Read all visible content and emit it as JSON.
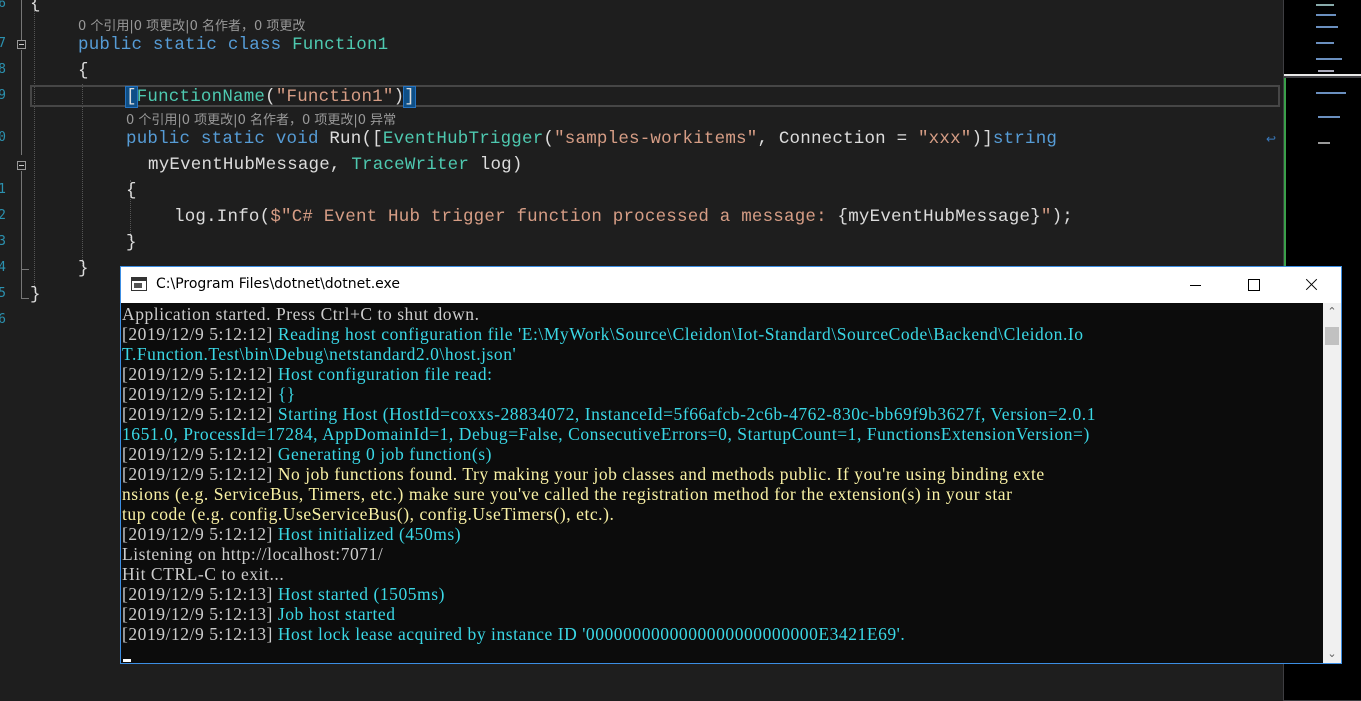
{
  "editor": {
    "line_numbers": [
      "6",
      "7",
      "8",
      "9",
      "0",
      "1",
      "2",
      "3",
      "4",
      "5",
      "6"
    ],
    "open_brace_top": "{",
    "codelens_class": "0 个引用|0 项更改|0 名作者，0 项更改",
    "codelens_method": "0 个引用|0 项更改|0 名作者，0 项更改|0 异常",
    "code": {
      "kw_public": "public",
      "kw_static": "static",
      "kw_class": "class",
      "class_name": "Function1",
      "brace_open": "{",
      "attr_open": "[",
      "attr_name": "FunctionName",
      "attr_paren_open": "(",
      "attr_value": "\"Function1\"",
      "attr_paren_close": ")",
      "attr_close": "]",
      "kw_void": "void",
      "method_name": "Run(",
      "trigger_open": "[",
      "trigger_name": "EventHubTrigger",
      "trigger_paren": "(",
      "trigger_value": "\"samples-workitems\"",
      "trigger_conn": ", Connection = ",
      "trigger_conn_value": "\"xxx\"",
      "trigger_close": ")]",
      "kw_string": "string",
      "param_line": "myEventHubMessage, ",
      "tracewriter": "TraceWriter",
      "log_param": " log)",
      "method_brace_open": "{",
      "log_call": "log.Info(",
      "log_string_open": "$\"C# Event Hub trigger function processed a message: ",
      "log_interp": "{myEventHubMessage}",
      "log_string_close": "\"",
      "log_end": ");",
      "method_brace_close": "}",
      "class_brace_close": "}",
      "ns_brace_close": "}"
    }
  },
  "console": {
    "title": "C:\\Program Files\\dotnet\\dotnet.exe",
    "lines": [
      {
        "ts": "",
        "text": "Application started. Press Ctrl+C to shut down.",
        "color": "gray"
      },
      {
        "ts": "[2019/12/9 5:12:12] ",
        "text": "Reading host configuration file 'E:\\MyWork\\Source\\Cleidon\\Iot-Standard\\SourceCode\\Backend\\Cleidon.Io",
        "color": "cyan"
      },
      {
        "ts": "",
        "text": "T.Function.Test\\bin\\Debug\\netstandard2.0\\host.json'",
        "color": "cyan"
      },
      {
        "ts": "[2019/12/9 5:12:12] ",
        "text": "Host configuration file read:",
        "color": "cyan"
      },
      {
        "ts": "[2019/12/9 5:12:12] ",
        "text": "{}",
        "color": "cyan"
      },
      {
        "ts": "[2019/12/9 5:12:12] ",
        "text": "Starting Host (HostId=coxxs-28834072, InstanceId=5f66afcb-2c6b-4762-830c-bb69f9b3627f, Version=2.0.1",
        "color": "cyan"
      },
      {
        "ts": "",
        "text": "1651.0, ProcessId=17284, AppDomainId=1, Debug=False, ConsecutiveErrors=0, StartupCount=1, FunctionsExtensionVersion=)",
        "color": "cyan"
      },
      {
        "ts": "[2019/12/9 5:12:12] ",
        "text": "Generating 0 job function(s)",
        "color": "cyan"
      },
      {
        "ts": "[2019/12/9 5:12:12] ",
        "text": "No job functions found. Try making your job classes and methods public. If you're using binding exte",
        "color": "yellow"
      },
      {
        "ts": "",
        "text": "nsions (e.g. ServiceBus, Timers, etc.) make sure you've called the registration method for the extension(s) in your star",
        "color": "yellow"
      },
      {
        "ts": "",
        "text": "tup code (e.g. config.UseServiceBus(), config.UseTimers(), etc.).",
        "color": "yellow"
      },
      {
        "ts": "[2019/12/9 5:12:12] ",
        "text": "Host initialized (450ms)",
        "color": "cyan"
      },
      {
        "ts": "",
        "text": "Listening on http://localhost:7071/",
        "color": "gray"
      },
      {
        "ts": "",
        "text": "Hit CTRL-C to exit...",
        "color": "gray"
      },
      {
        "ts": "[2019/12/9 5:12:13] ",
        "text": "Host started (1505ms)",
        "color": "cyan"
      },
      {
        "ts": "[2019/12/9 5:12:13] ",
        "text": "Job host started",
        "color": "cyan"
      },
      {
        "ts": "[2019/12/9 5:12:13] ",
        "text": "Host lock lease acquired by instance ID '0000000000000000000000000E3421E69'.",
        "color": "cyan"
      }
    ]
  },
  "colors": {
    "editor_bg": "#1e1e1e",
    "keyword": "#569cd6",
    "type": "#4ec9b0",
    "string": "#d69d85",
    "console_cyan": "#3ad8e6",
    "console_yellow": "#f9f1a5",
    "console_gray": "#cccccc"
  },
  "icons": {
    "window_icon": "console-window-icon",
    "minimize": "minimize-icon",
    "maximize": "maximize-icon",
    "close": "close-icon"
  }
}
